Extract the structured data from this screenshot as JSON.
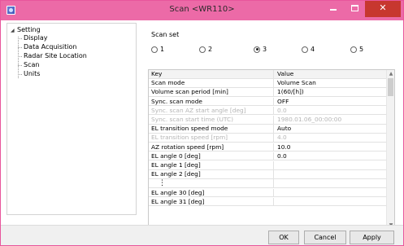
{
  "window": {
    "title": "Scan <WR110>",
    "accent_color": "#ec6aa7",
    "close_color": "#c7372f",
    "minimize_icon": "minimize-icon",
    "maximize_icon": "maximize-icon",
    "close_icon": "close-icon",
    "close_label": "✕"
  },
  "tree": {
    "root": "Setting",
    "children": [
      "Display",
      "Data Acquisition",
      "Radar Site Location",
      "Scan",
      "Units"
    ]
  },
  "scanset": {
    "title": "Scan set",
    "options": [
      "1",
      "2",
      "3",
      "4",
      "5"
    ],
    "selected": "3"
  },
  "grid": {
    "headers": {
      "key": "Key",
      "value": "Value"
    },
    "rows": [
      {
        "key": "Scan mode",
        "value": "Volume Scan",
        "disabled": false
      },
      {
        "key": "Volume scan period [min]",
        "value": "1(60/[h])",
        "disabled": false
      },
      {
        "key": "Sync. scan mode",
        "value": "OFF",
        "disabled": false
      },
      {
        "key": "Sync. scan AZ start angle [deg]",
        "value": "0.0",
        "disabled": true
      },
      {
        "key": "Sync. scan start time (UTC)",
        "value": "1980.01.06_00:00:00",
        "disabled": true
      },
      {
        "key": "EL transition speed mode",
        "value": "Auto",
        "disabled": false
      },
      {
        "key": "EL transition speed [rpm]",
        "value": "4.0",
        "disabled": true
      },
      {
        "key": "AZ rotation speed [rpm]",
        "value": "10.0",
        "disabled": false
      },
      {
        "key": "EL angle 0 [deg]",
        "value": "0.0",
        "disabled": false
      },
      {
        "key": "EL angle 1 [deg]",
        "value": "",
        "disabled": false
      },
      {
        "key": "EL angle 2 [deg]",
        "value": "",
        "disabled": false
      },
      {
        "key": "⋮",
        "value": "",
        "disabled": false
      },
      {
        "key": "EL angle 30 [deg]",
        "value": "",
        "disabled": false
      },
      {
        "key": "EL angle 31 [deg]",
        "value": "",
        "disabled": false
      }
    ]
  },
  "buttons": {
    "ok": "OK",
    "cancel": "Cancel",
    "apply": "Apply"
  }
}
